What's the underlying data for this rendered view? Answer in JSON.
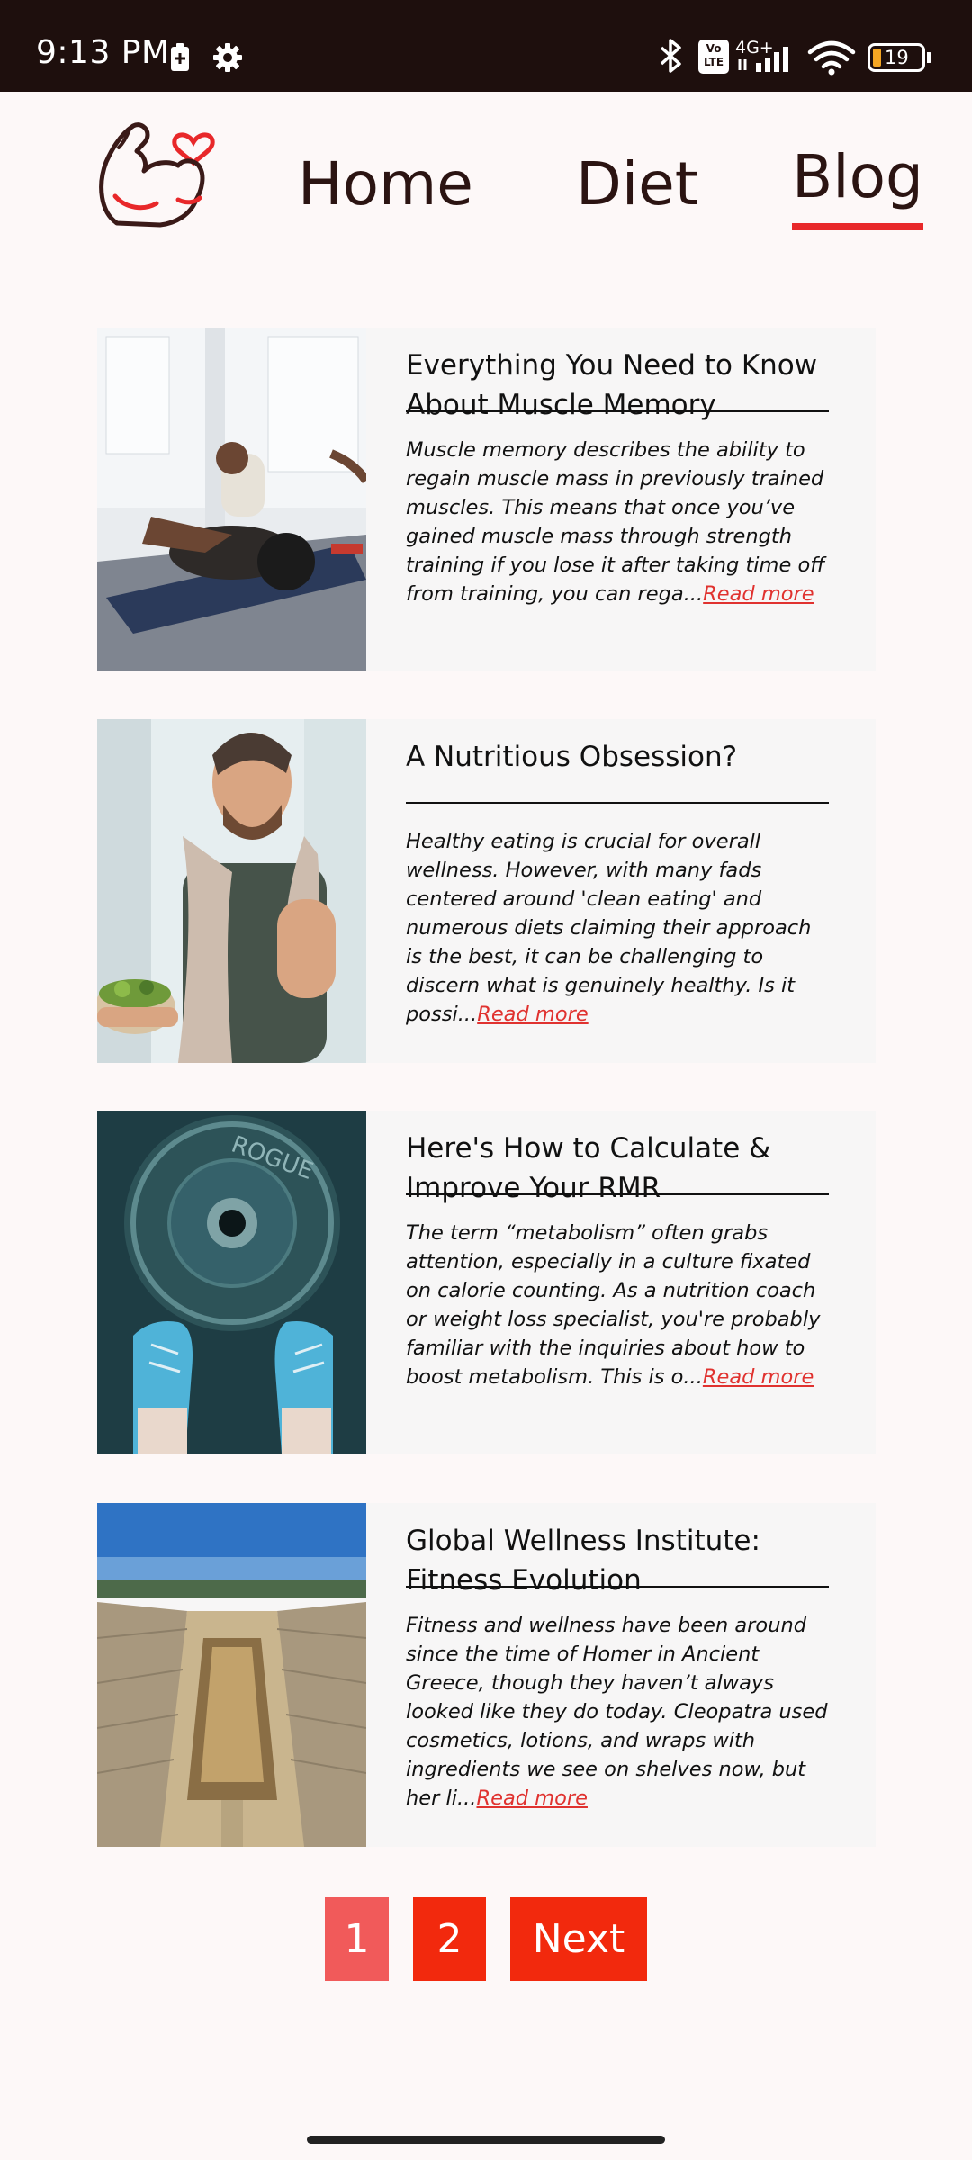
{
  "status_bar": {
    "time": "9:13 PM",
    "battery": "19",
    "network": "4G+",
    "volte": "Vo LTE"
  },
  "nav": {
    "logo_icon": "flexed-arm-heart-icon",
    "home": "Home",
    "diet": "Diet",
    "blog": "Blog",
    "active": "Blog",
    "active_color": "#e8282a"
  },
  "posts": [
    {
      "title": "Everything You Need to Know About Muscle Memory",
      "excerpt": "Muscle memory describes the ability to regain muscle mass in previously trained muscles. This means that once you’ve gained muscle mass through strength training if you lose it after taking time off from training, you can rega...",
      "read_more": "Read more",
      "image": "man-medicine-ball-photo"
    },
    {
      "title": "A Nutritious Obsession?",
      "excerpt": "Healthy eating is crucial for overall wellness. However, with many fads centered around 'clean eating' and numerous diets claiming their approach is the best, it can be challenging to discern what is genuinely healthy. Is it possi...",
      "read_more": "Read more",
      "image": "man-eating-salad-photo"
    },
    {
      "title": "Here's How to Calculate & Improve Your RMR",
      "excerpt": "The term “metabolism” often grabs attention, especially in a culture fixated on calorie counting. As a nutrition coach or weight loss specialist, you're probably familiar with the inquiries about how to boost metabolism. This is o...",
      "read_more": "Read more",
      "image": "weight-plate-sneakers-photo"
    },
    {
      "title": "Global Wellness Institute: Fitness Evolution",
      "excerpt": "Fitness and wellness have been around since the time of Homer in Ancient Greece, though they haven’t always looked like they do today. Cleopatra used cosmetics, lotions, and wraps with ingredients we see on shelves now, but her li...",
      "read_more": "Read more",
      "image": "ancient-stadium-photo"
    }
  ],
  "pagination": {
    "page1": "1",
    "page2": "2",
    "next": "Next",
    "current": "1"
  }
}
